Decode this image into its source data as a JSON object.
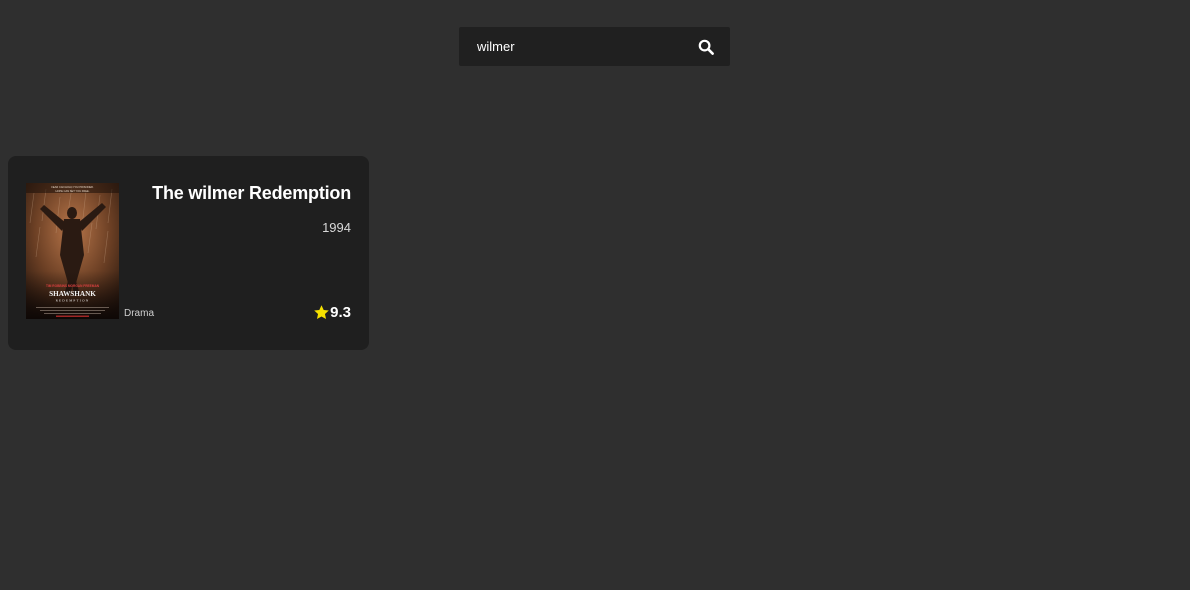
{
  "search": {
    "value": "wilmer",
    "icon": "search-icon"
  },
  "results": [
    {
      "title": "The wilmer Redemption",
      "year": "1994",
      "genre": "Drama",
      "rating": "9.3",
      "poster": {
        "tagline": "FEAR CAN HOLD YOU PRISONER. HOPE CAN SET YOU FREE.",
        "credits": "TIM ROBBINS   MORGAN FREEMAN",
        "film_title": "SHAWSHANK",
        "film_subtitle": "REDEMPTION"
      }
    }
  ],
  "colors": {
    "background": "#2f2f2f",
    "card": "#1f1f1f",
    "search_bar": "#202020",
    "star": "#f5e000"
  }
}
